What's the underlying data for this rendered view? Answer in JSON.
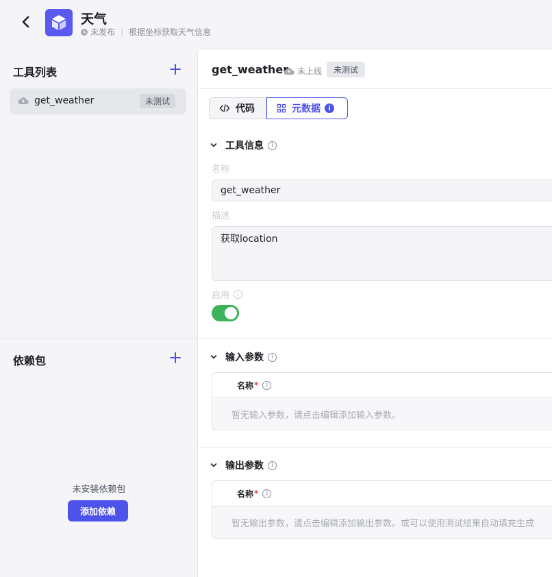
{
  "header": {
    "title": "天气",
    "status": "未发布",
    "description": "根据坐标获取天气信息",
    "logo_icon": "cube-icon",
    "brand_color": "#5a5af0"
  },
  "left": {
    "tools_title": "工具列表",
    "tools": [
      {
        "name": "get_weather",
        "badge": "未测试",
        "icon": "cloud-icon"
      }
    ],
    "deps_title": "依赖包",
    "deps_empty": "未安装依赖包",
    "add_dep_label": "添加依赖"
  },
  "main": {
    "tool_name": "get_weather",
    "online_status": "未上线",
    "test_badge": "未测试",
    "tabs": [
      {
        "label": "代码",
        "active": false
      },
      {
        "label": "元数据",
        "active": true
      }
    ],
    "tool_info": {
      "title": "工具信息",
      "name_label": "名称",
      "name_value": "get_weather",
      "desc_label": "描述",
      "desc_value": "获取location",
      "enabled_label": "启用",
      "enabled": true
    },
    "input_params": {
      "title": "输入参数",
      "col_name": "名称",
      "required_mark": "*",
      "empty": "暂无输入参数，请点击编辑添加输入参数。"
    },
    "output_params": {
      "title": "输出参数",
      "col_name": "名称",
      "required_mark": "*",
      "empty": "暂无输出参数，请点击编辑添加输出参数。或可以使用测试结果自动填充生成"
    }
  },
  "colors": {
    "accent": "#4d53e8",
    "toggle_on": "#3cb35a",
    "required": "#e5484d"
  }
}
